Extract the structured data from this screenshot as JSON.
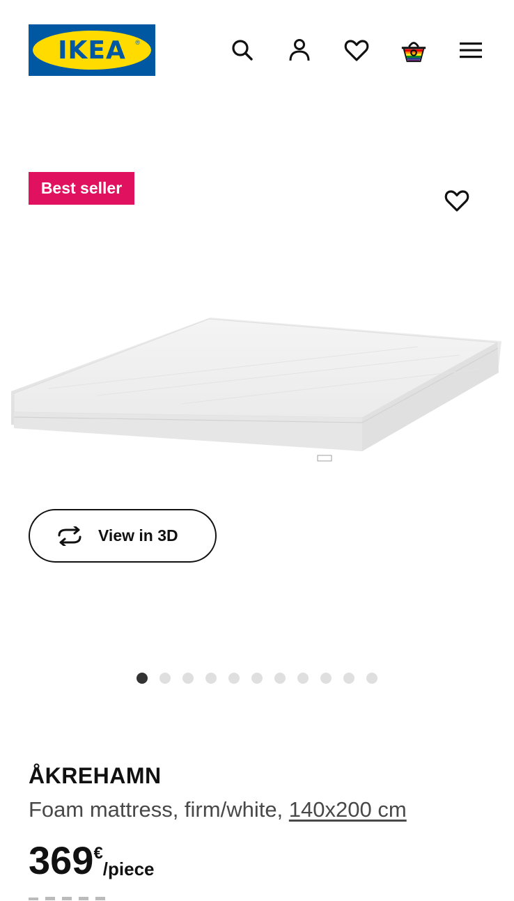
{
  "header": {
    "logo_text": "IKEA",
    "logo_reg": "®",
    "icons": [
      "search-icon",
      "account-icon",
      "heart-icon",
      "basket-icon",
      "menu-icon"
    ],
    "brand_colors": {
      "blue": "#0058a3",
      "yellow": "#ffdb00"
    }
  },
  "product": {
    "badge": "Best seller",
    "badge_color": "#e0115f",
    "view3d_label": "View in 3D",
    "gallery": {
      "total_images": 11,
      "active_index": 0
    },
    "name": "ÅKREHAMN",
    "description": "Foam mattress, firm/white, ",
    "size": "140x200 cm",
    "price": {
      "amount": "369",
      "currency": "€",
      "unit": "/piece"
    }
  }
}
